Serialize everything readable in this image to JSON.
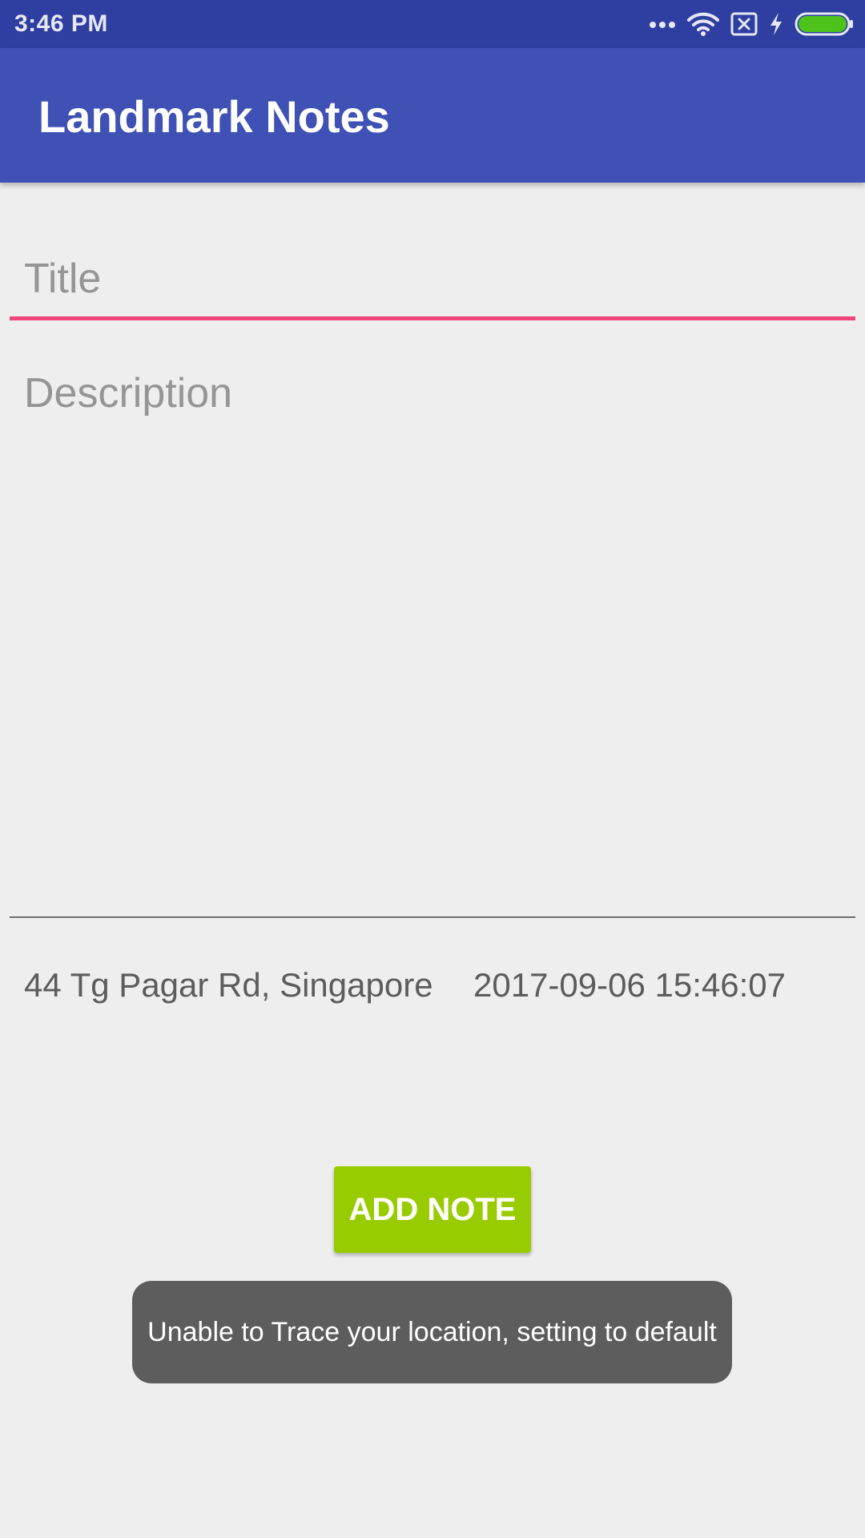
{
  "status_bar": {
    "time": "3:46 PM",
    "icons": [
      "more-dots-icon",
      "wifi-icon",
      "sim-missing-icon",
      "charging-bolt-icon",
      "battery-icon"
    ],
    "battery_color": "#4cc21b",
    "background": "#2f3ea1"
  },
  "app_bar": {
    "title": "Landmark Notes",
    "background": "#3f51b5"
  },
  "form": {
    "title_placeholder": "Title",
    "title_value": "",
    "description_placeholder": "Description",
    "description_value": "",
    "focus_color": "#f0457b"
  },
  "info": {
    "location": "44 Tg Pagar Rd, Singapore",
    "datetime": "2017-09-06 15:46:07"
  },
  "actions": {
    "add_note_label": "ADD NOTE",
    "add_note_color": "#99cc00"
  },
  "toast": {
    "message": "Unable to Trace your location, setting to default"
  }
}
